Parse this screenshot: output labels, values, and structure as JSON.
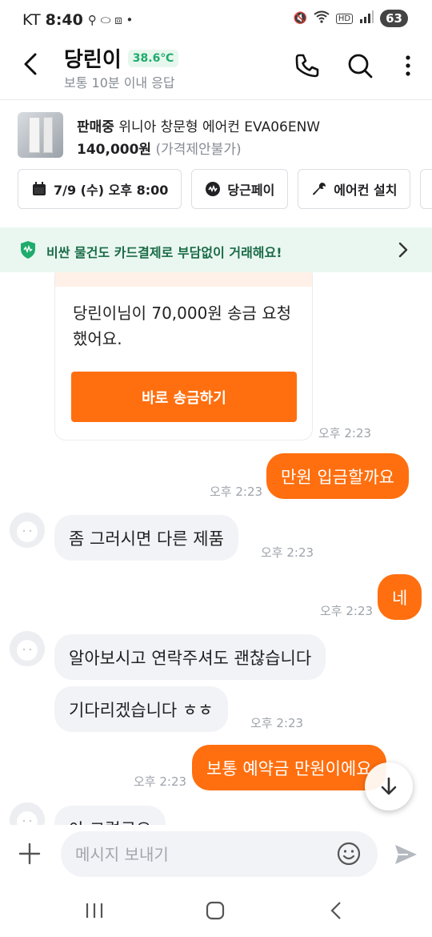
{
  "status_bar": {
    "carrier": "KT",
    "time": "8:40",
    "battery": "63"
  },
  "header": {
    "title": "당린이",
    "temperature": "38.6℃",
    "subtitle": "보통 10분 이내 응답"
  },
  "product": {
    "status": "판매중",
    "name": "위니아 창문형 에어컨 EVA06ENW",
    "price": "140,000원",
    "negotiable": "(가격제안불가)"
  },
  "chips": [
    {
      "label": "7/9 (수) 오후 8:00"
    },
    {
      "label": "당근페이"
    },
    {
      "label": "에어컨 설치"
    }
  ],
  "banner": {
    "text": "비싼 물건도 카드결제로 부담없이 거래해요!"
  },
  "pay_card": {
    "text": "당린이님이 70,000원 송금 요청했어요.",
    "button": "바로 송금하기",
    "time": "오후 2:23"
  },
  "messages": [
    {
      "from": "me",
      "text": "만원 입금할까요",
      "time": "오후 2:23"
    },
    {
      "from": "them",
      "text": "좀 그러시면 다른 제품",
      "time": "오후 2:23"
    },
    {
      "from": "me",
      "text": "네",
      "time": "오후 2:23"
    },
    {
      "from": "them",
      "text": "알아보시고 연락주셔도 괜찮습니다",
      "time": ""
    },
    {
      "from": "them",
      "text": "기다리겠습니다 ㅎㅎ",
      "time": "오후 2:23"
    },
    {
      "from": "me",
      "text": "보통 예약금 만원이에요",
      "time": "오후 2:23"
    },
    {
      "from": "them",
      "text": "아 그렇군요",
      "time": ""
    }
  ],
  "composer": {
    "placeholder": "메시지 보내기"
  },
  "colors": {
    "accent": "#ff6f0f",
    "temperature": "#1fab6c",
    "banner_bg": "#eaf7f1"
  }
}
